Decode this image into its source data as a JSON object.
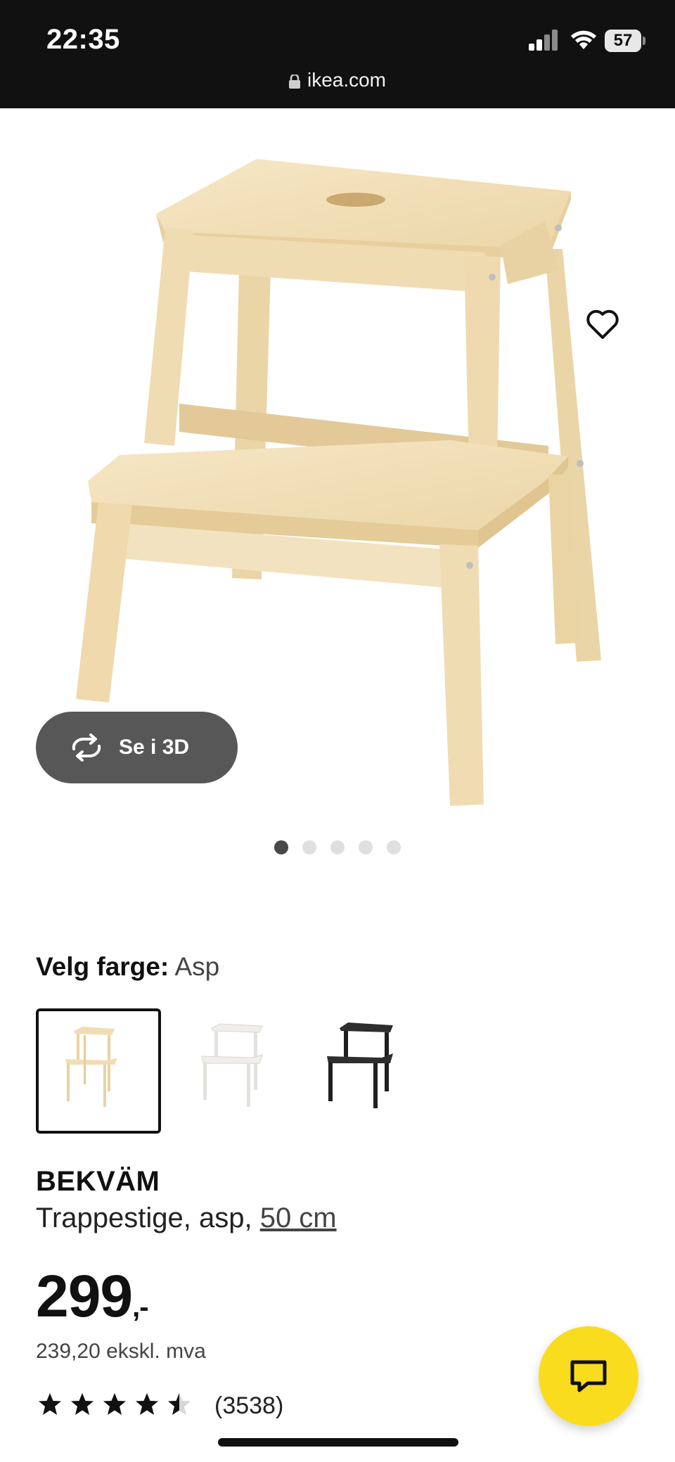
{
  "status_bar": {
    "time": "22:35",
    "url": "ikea.com",
    "battery": "57",
    "icons": [
      "signal-icon",
      "wifi-icon",
      "battery-icon"
    ]
  },
  "gallery": {
    "view_3d_label": "Se i 3D",
    "image_count": 5,
    "active_index": 0
  },
  "color_selector": {
    "label": "Velg farge:",
    "value": "Asp",
    "options": [
      "asp",
      "white",
      "black"
    ],
    "selected_index": 0
  },
  "product": {
    "name": "BEKVÄM",
    "description": "Trappestige, asp, ",
    "size_link": "50 cm",
    "price": "299",
    "price_suffix": ",-",
    "price_ex_vat": "239,20 ekskl. mva",
    "rating": 4.5,
    "review_count": "(3538)"
  },
  "colors": {
    "brand_yellow": "#fadc1e",
    "statusbar": "#111111",
    "wood": "#f1ddb4"
  }
}
